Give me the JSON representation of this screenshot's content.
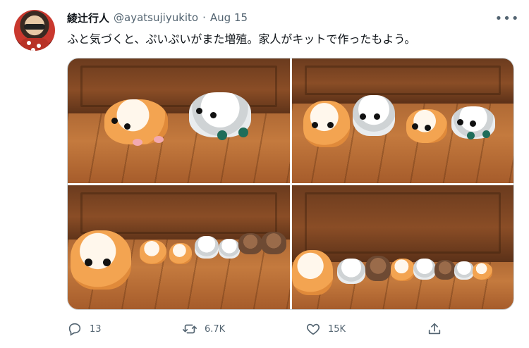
{
  "author": {
    "display_name": "綾辻行人",
    "handle": "@ayatsujiyukito",
    "separator": "·",
    "date": "Aug 15"
  },
  "tweet": {
    "text": "ふと気づくと、ぷいぷいがまた増殖。家人がキットで作ったもよう。"
  },
  "media": {
    "photo_count": 4
  },
  "actions": {
    "replies": "13",
    "retweets": "6.7K",
    "likes": "15K"
  },
  "icons": {
    "more": "more-dots-icon",
    "reply": "reply-icon",
    "retweet": "retweet-icon",
    "like": "heart-icon",
    "share": "share-icon"
  },
  "colors": {
    "text_primary": "#0f1419",
    "text_secondary": "#536471",
    "border": "#cfd9de"
  }
}
